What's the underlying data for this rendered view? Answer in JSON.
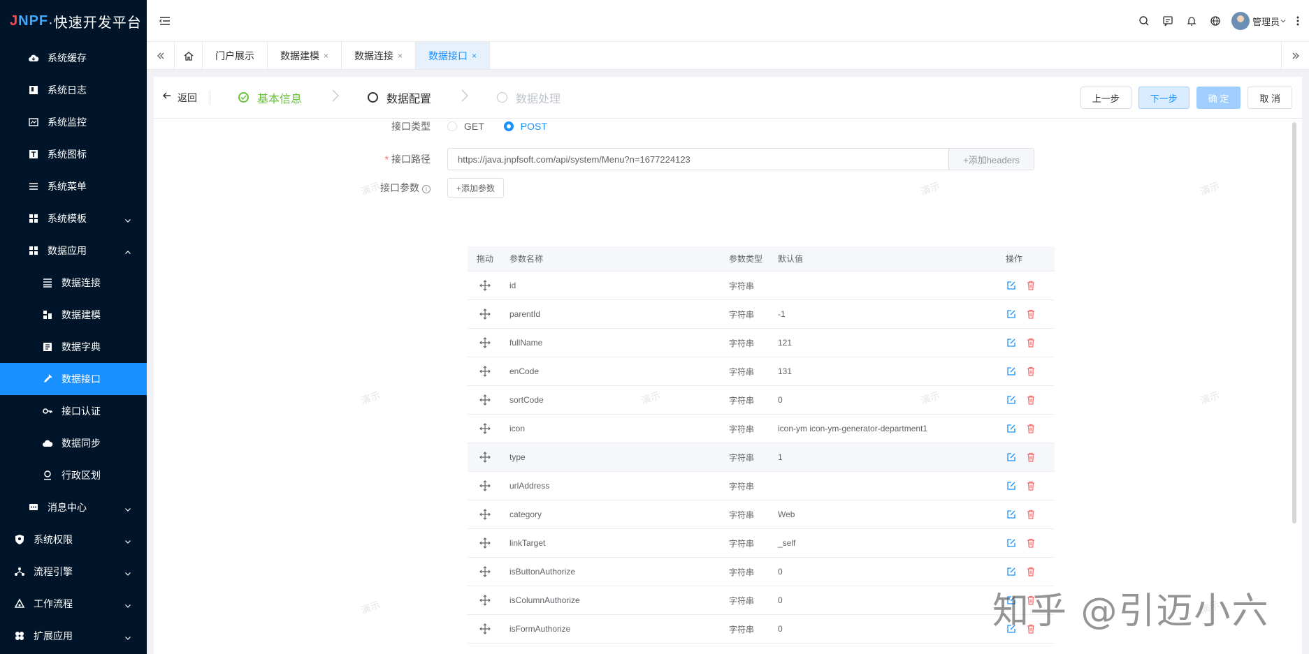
{
  "app": {
    "logo_j": "J",
    "logo_n": "N",
    "logo_pf": "PF",
    "logo_rest": "·快速开发平台"
  },
  "sidebar": {
    "items": [
      {
        "label": "系统缓存",
        "icon": "cloud-icon"
      },
      {
        "label": "系统日志",
        "icon": "log-icon"
      },
      {
        "label": "系统监控",
        "icon": "monitor-icon"
      },
      {
        "label": "系统图标",
        "icon": "text-icon"
      },
      {
        "label": "系统菜单",
        "icon": "menu-icon"
      },
      {
        "label": "系统模板",
        "icon": "template-icon"
      },
      {
        "label": "数据应用",
        "icon": "apps-icon"
      },
      {
        "label": "数据连接",
        "icon": "list-icon"
      },
      {
        "label": "数据建模",
        "icon": "model-icon"
      },
      {
        "label": "数据字典",
        "icon": "dict-icon"
      },
      {
        "label": "数据接口",
        "icon": "api-icon"
      },
      {
        "label": "接口认证",
        "icon": "key-icon"
      },
      {
        "label": "数据同步",
        "icon": "sync-icon"
      },
      {
        "label": "行政区划",
        "icon": "location-icon"
      },
      {
        "label": "消息中心",
        "icon": "message-icon"
      },
      {
        "label": "系统权限",
        "icon": "shield-icon"
      },
      {
        "label": "流程引擎",
        "icon": "flow-icon"
      },
      {
        "label": "工作流程",
        "icon": "workflow-icon"
      },
      {
        "label": "扩展应用",
        "icon": "extend-icon"
      }
    ]
  },
  "header": {
    "user_name": "管理员"
  },
  "tabs": [
    {
      "label": "门户展示"
    },
    {
      "label": "数据建模",
      "close": "×"
    },
    {
      "label": "数据连接",
      "close": "×"
    },
    {
      "label": "数据接口",
      "close": "×"
    }
  ],
  "steps": {
    "back": "返回",
    "items": [
      {
        "label": "基本信息"
      },
      {
        "label": "数据配置"
      },
      {
        "label": "数据处理"
      }
    ],
    "buttons": {
      "prev": "上一步",
      "next": "下一步",
      "ok": "确 定",
      "cancel": "取 消"
    }
  },
  "form": {
    "type_label": "接口类型",
    "type_options": [
      "GET",
      "POST"
    ],
    "type_selected": "POST",
    "path_label": "接口路径",
    "path_value": "https://java.jnpfsoft.com/api/system/Menu?n=1677224123",
    "add_headers": "+添加headers",
    "param_label": "接口参数",
    "info_glyph": "i",
    "add_param": "+添加参数"
  },
  "table": {
    "headers": {
      "drag": "拖动",
      "name": "参数名称",
      "type": "参数类型",
      "default": "默认值",
      "action": "操作"
    },
    "rows": [
      {
        "name": "id",
        "type": "字符串",
        "default": ""
      },
      {
        "name": "parentId",
        "type": "字符串",
        "default": "-1"
      },
      {
        "name": "fullName",
        "type": "字符串",
        "default": "121"
      },
      {
        "name": "enCode",
        "type": "字符串",
        "default": "131"
      },
      {
        "name": "sortCode",
        "type": "字符串",
        "default": "0"
      },
      {
        "name": "icon",
        "type": "字符串",
        "default": "icon-ym icon-ym-generator-department1"
      },
      {
        "name": "type",
        "type": "字符串",
        "default": "1"
      },
      {
        "name": "urlAddress",
        "type": "字符串",
        "default": ""
      },
      {
        "name": "category",
        "type": "字符串",
        "default": "Web"
      },
      {
        "name": "linkTarget",
        "type": "字符串",
        "default": "_self"
      },
      {
        "name": "isButtonAuthorize",
        "type": "字符串",
        "default": "0"
      },
      {
        "name": "isColumnAuthorize",
        "type": "字符串",
        "default": "0"
      },
      {
        "name": "isFormAuthorize",
        "type": "字符串",
        "default": "0"
      }
    ]
  },
  "watermark": {
    "text": "演示",
    "credit": "知乎 @引迈小六"
  },
  "colors": {
    "primary": "#1890ff",
    "sidebar_bg": "#001529",
    "success": "#67c23a",
    "danger": "#f56c6c"
  }
}
